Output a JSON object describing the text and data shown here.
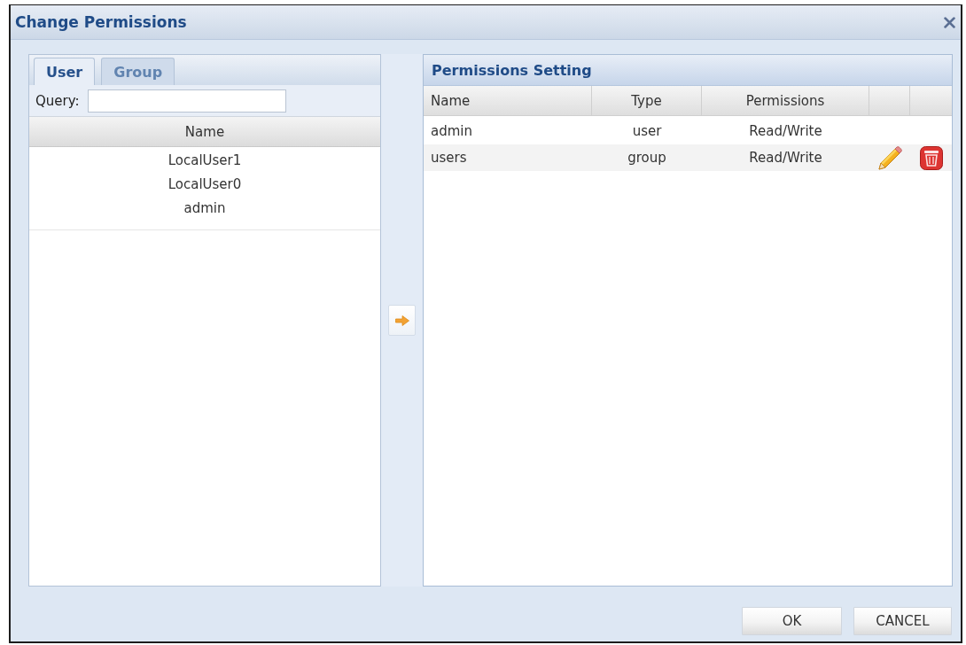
{
  "window": {
    "title": "Change Permissions"
  },
  "tabs": [
    {
      "label": "User",
      "selected": true
    },
    {
      "label": "Group",
      "selected": false
    }
  ],
  "query": {
    "label": "Query:"
  },
  "user_list": {
    "column": "Name",
    "items": [
      {
        "name": "LocalUser1",
        "selected": false
      },
      {
        "name": "LocalUser0",
        "selected": false
      },
      {
        "name": "admin",
        "selected": false
      }
    ]
  },
  "permissions_setting": {
    "title": "Permissions Setting",
    "columns": [
      "Name",
      "Type",
      "Permissions"
    ],
    "rows": [
      {
        "name": "admin",
        "type": "user",
        "permissions": "Read/Write",
        "highlighted": false
      },
      {
        "name": "users",
        "type": "group",
        "permissions": "Read/Write",
        "highlighted": true
      }
    ]
  },
  "buttons": [
    {
      "label": "OK"
    },
    {
      "label": "CANCEL"
    }
  ]
}
